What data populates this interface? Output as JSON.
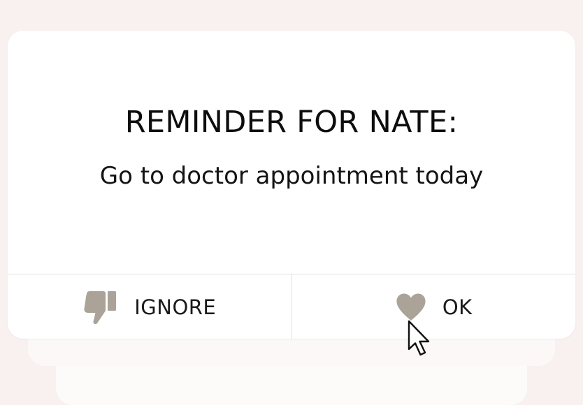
{
  "dialog": {
    "title": "REMINDER FOR NATE:",
    "message": "Go to doctor appointment today"
  },
  "actions": {
    "ignore": {
      "label": "IGNORE",
      "icon": "thumbs-down-icon"
    },
    "ok": {
      "label": "OK",
      "icon": "heart-icon"
    }
  },
  "colors": {
    "background": "#f8f1f0",
    "card": "#ffffff",
    "icon": "#aba398",
    "divider": "#e4dfda",
    "text": "#0d0d0d"
  }
}
